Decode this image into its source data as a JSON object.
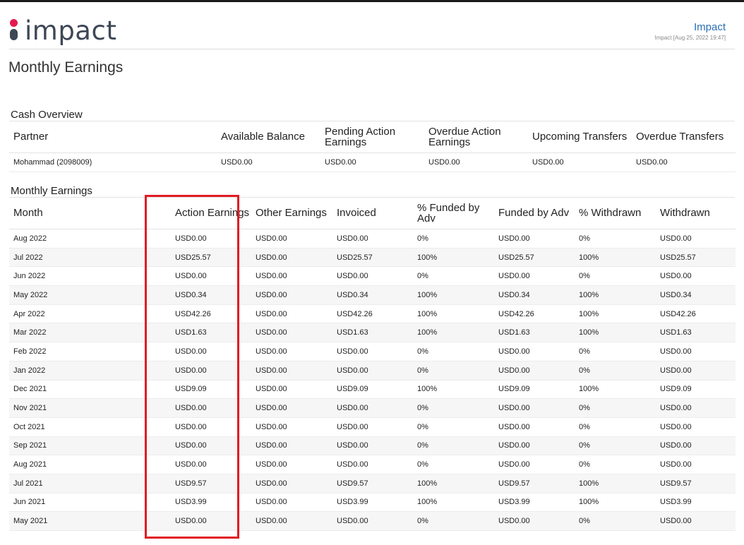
{
  "header": {
    "logo_text": "impact",
    "brand": "Impact",
    "stamp": "Impact [Aug 25, 2022 19:47]"
  },
  "page_title": "Monthly Earnings",
  "cash_overview": {
    "title": "Cash Overview",
    "columns": [
      "Partner",
      "Available Balance",
      "Pending Action Earnings",
      "Overdue Action Earnings",
      "Upcoming Transfers",
      "Overdue Transfers"
    ],
    "rows": [
      [
        "Mohammad (2098009)",
        "USD0.00",
        "USD0.00",
        "USD0.00",
        "USD0.00",
        "USD0.00"
      ]
    ]
  },
  "monthly_earnings": {
    "title": "Monthly Earnings",
    "columns": [
      "Month",
      "Action Earnings",
      "Other Earnings",
      "Invoiced",
      "% Funded by Adv",
      "Funded by Adv",
      "% Withdrawn",
      "Withdrawn"
    ],
    "rows": [
      [
        "Aug 2022",
        "USD0.00",
        "USD0.00",
        "USD0.00",
        "0%",
        "USD0.00",
        "0%",
        "USD0.00"
      ],
      [
        "Jul 2022",
        "USD25.57",
        "USD0.00",
        "USD25.57",
        "100%",
        "USD25.57",
        "100%",
        "USD25.57"
      ],
      [
        "Jun 2022",
        "USD0.00",
        "USD0.00",
        "USD0.00",
        "0%",
        "USD0.00",
        "0%",
        "USD0.00"
      ],
      [
        "May 2022",
        "USD0.34",
        "USD0.00",
        "USD0.34",
        "100%",
        "USD0.34",
        "100%",
        "USD0.34"
      ],
      [
        "Apr 2022",
        "USD42.26",
        "USD0.00",
        "USD42.26",
        "100%",
        "USD42.26",
        "100%",
        "USD42.26"
      ],
      [
        "Mar 2022",
        "USD1.63",
        "USD0.00",
        "USD1.63",
        "100%",
        "USD1.63",
        "100%",
        "USD1.63"
      ],
      [
        "Feb 2022",
        "USD0.00",
        "USD0.00",
        "USD0.00",
        "0%",
        "USD0.00",
        "0%",
        "USD0.00"
      ],
      [
        "Jan 2022",
        "USD0.00",
        "USD0.00",
        "USD0.00",
        "0%",
        "USD0.00",
        "0%",
        "USD0.00"
      ],
      [
        "Dec 2021",
        "USD9.09",
        "USD0.00",
        "USD9.09",
        "100%",
        "USD9.09",
        "100%",
        "USD9.09"
      ],
      [
        "Nov 2021",
        "USD0.00",
        "USD0.00",
        "USD0.00",
        "0%",
        "USD0.00",
        "0%",
        "USD0.00"
      ],
      [
        "Oct 2021",
        "USD0.00",
        "USD0.00",
        "USD0.00",
        "0%",
        "USD0.00",
        "0%",
        "USD0.00"
      ],
      [
        "Sep 2021",
        "USD0.00",
        "USD0.00",
        "USD0.00",
        "0%",
        "USD0.00",
        "0%",
        "USD0.00"
      ],
      [
        "Aug 2021",
        "USD0.00",
        "USD0.00",
        "USD0.00",
        "0%",
        "USD0.00",
        "0%",
        "USD0.00"
      ],
      [
        "Jul 2021",
        "USD9.57",
        "USD0.00",
        "USD9.57",
        "100%",
        "USD9.57",
        "100%",
        "USD9.57"
      ],
      [
        "Jun 2021",
        "USD3.99",
        "USD0.00",
        "USD3.99",
        "100%",
        "USD3.99",
        "100%",
        "USD3.99"
      ],
      [
        "May 2021",
        "USD0.00",
        "USD0.00",
        "USD0.00",
        "0%",
        "USD0.00",
        "0%",
        "USD0.00"
      ]
    ]
  },
  "colors": {
    "highlight": "#e21b23",
    "brand_link": "#2a6eb5",
    "logo_dot": "#e5194f",
    "logo_text": "#3d4756"
  }
}
